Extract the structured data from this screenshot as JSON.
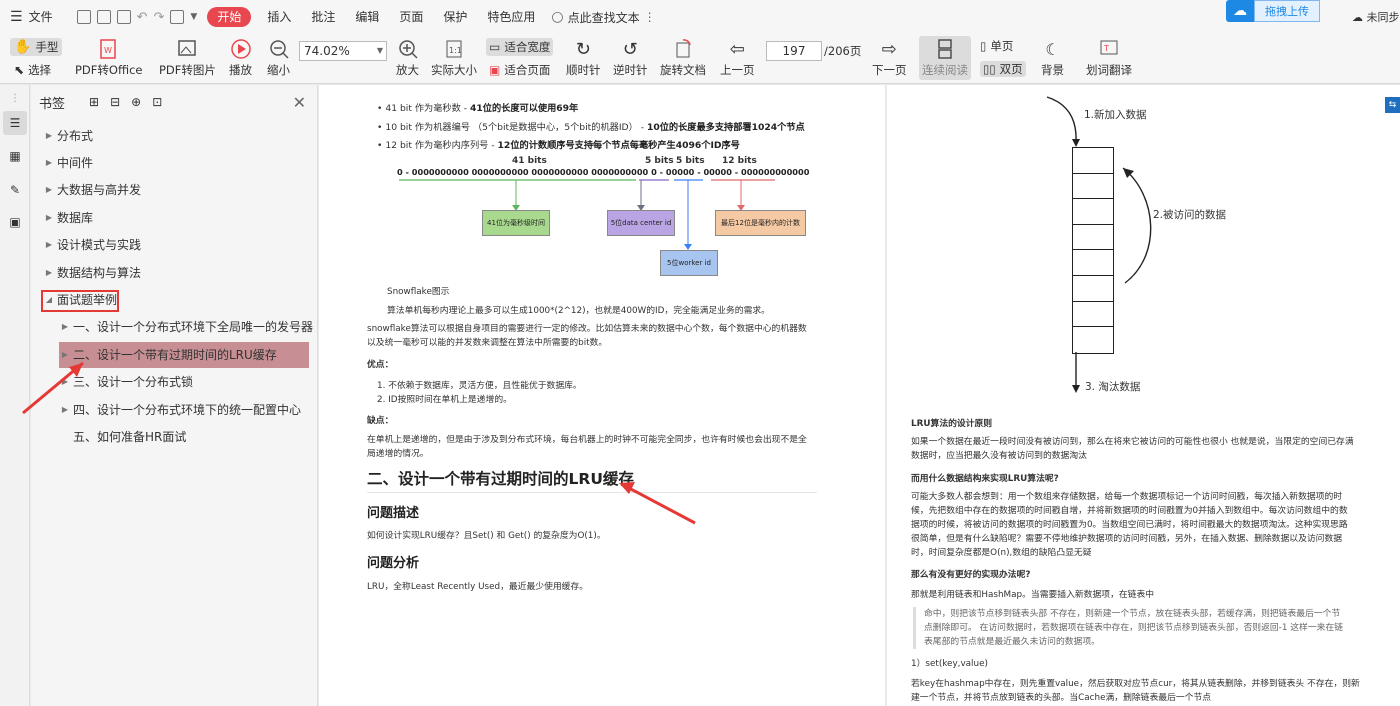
{
  "menu": {
    "file": "文件",
    "start": "开始",
    "items": [
      "插入",
      "批注",
      "编辑",
      "页面",
      "保护",
      "特色应用"
    ],
    "search": "点此查找文本"
  },
  "cloud": {
    "label": "拖拽上传",
    "sync": "未同步"
  },
  "toolbar": {
    "hand": "手型",
    "select": "选择",
    "pdf_office": "PDF转Office",
    "pdf_img": "PDF转图片",
    "play": "播放",
    "zoom_out": "缩小",
    "zoom_value": "74.02%",
    "zoom_in": "放大",
    "actual_size": "实际大小",
    "fit_width": "适合宽度",
    "fit_page": "适合页面",
    "cw": "顺时针",
    "ccw": "逆时针",
    "rotate": "旋转文档",
    "prev": "上一页",
    "page_current": "197",
    "page_total": "/206页",
    "next": "下一页",
    "continuous": "连续阅读",
    "single": "单页",
    "double": "双页",
    "background": "背景",
    "translate": "划词翻译"
  },
  "bookmark": {
    "title": "书签",
    "items": [
      {
        "label": "分布式"
      },
      {
        "label": "中间件"
      },
      {
        "label": "大数据与高并发"
      },
      {
        "label": "数据库"
      },
      {
        "label": "设计模式与实践"
      },
      {
        "label": "数据结构与算法"
      },
      {
        "label": "面试题举例"
      }
    ],
    "children": [
      {
        "label": "一、设计一个分布式环境下全局唯一的发号器"
      },
      {
        "label": "二、设计一个带有过期时间的LRU缓存"
      },
      {
        "label": "三、设计一个分布式锁"
      },
      {
        "label": "四、设计一个分布式环境下的统一配置中心"
      },
      {
        "label": "五、如何准备HR面试"
      }
    ]
  },
  "left_page": {
    "b1": "41 bit 作为毫秒数 - ",
    "b1b": "41位的长度可以使用69年",
    "b2": "10 bit 作为机器编号 （5个bit是数据中心，5个bit的机器ID） - ",
    "b2b": "10位的长度最多支持部署1024个节点",
    "b3": "12 bit 作为毫秒内序列号 - ",
    "b3b": "12位的计数顺序号支持每个节点每毫秒产生4096个ID序号",
    "bits41": "41 bits",
    "bits5a": "5 bits",
    "bits5b": "5 bits",
    "bits12": "12 bits",
    "binary": "0 - 0000000000 0000000000 0000000000 0000000000 0 - 00000 - 00000 - 000000000000",
    "box1": "41位为毫秒级时间",
    "box2": "5位data center id",
    "box3": "最后12位是毫秒内的计数",
    "box4": "5位worker id",
    "caption": "Snowflake图示",
    "p1": "算法单机每秒内理论上最多可以生成1000*(2^12)，也就是400W的ID，完全能满足业务的需求。",
    "p2a": "snowflake算法可以根据自身项目的需要进行一定的修改。比如估算未来的数据中心个数，每个数据中心的机器数",
    "p2b": "以及统一毫秒可以能的并发数来调整在算法中所需要的bit数。",
    "pros": "优点：",
    "pro1": "1. 不依赖于数据库，灵活方便，且性能优于数据库。",
    "pro2": "2. ID按照时间在单机上是递增的。",
    "cons": "缺点：",
    "con1a": "在单机上是递增的，但是由于涉及到分布式环境，每台机器上的时钟不可能完全同步，也许有时候也会出现不是全",
    "con1b": "局递增的情况。",
    "h2": "二、设计一个带有过期时间的LRU缓存",
    "h3a": "问题描述",
    "q1": "如何设计实现LRU缓存？且Set() 和 Get() 的复杂度为O(1)。",
    "h3b": "问题分析",
    "q2": "LRU，全称Least Recently Used，最近最少使用缓存。"
  },
  "right_page": {
    "l1": "1.新加入数据",
    "l2": "2.被访问的数据",
    "l3": "3. 淘汰数据",
    "s1": "LRU算法的设计原则",
    "p1a": "如果一个数据在最近一段时间没有被访问到，那么在将来它被访问的可能性也很小 也就是说，当限定的空间已存满",
    "p1b": "数据时，应当把最久没有被访问到的数据淘汰",
    "s2": "而用什么数据结构来实现LRU算法呢?",
    "p2a": "可能大多数人都会想到：用一个数组来存储数据，给每一个数据项标记一个访问时间戳，每次插入新数据项的时",
    "p2b": "候，先把数组中存在的数据项的时间戳自增，并将新数据项的时间戳置为0并插入到数组中。每次访问数组中的数",
    "p2c": "据项的时候，将被访问的数据项的时间戳置为0。当数组空间已满时，将时间戳最大的数据项淘汰。这种实现思路",
    "p2d": "很简单，但是有什么缺陷呢？需要不停地维护数据项的访问时间戳，另外，在插入数据、删除数据以及访问数据",
    "p2e": "时，时间复杂度都是O(n),数组的缺陷凸显无疑",
    "s3": "那么有没有更好的实现办法呢?",
    "p3": "那就是利用链表和HashMap。当需要插入新数据项，在链表中",
    "qa": "命中，则把该节点移到链表头部 不存在，则新建一个节点，放在链表头部，若缓存满，则把链表最后一个节",
    "qb": "点删除即可。 在访问数据时，若数据项在链表中存在，则把该节点移到链表头部，否则返回-1 这样一来在链",
    "qc": "表尾部的节点就是最近最久未访问的数据项。",
    "p4": "1）set(key,value)",
    "p5a": "若key在hashmap中存在，则先重置value，然后获取对应节点cur，将其从链表删除，并移到链表头 不存在，则新",
    "p5b": "建一个节点，并将节点放到链表的头部。当Cache满，删除链表最后一个节点"
  },
  "colors": {
    "accent": "#e8474f",
    "highlight": "#c78f93",
    "red": "#e53935"
  }
}
